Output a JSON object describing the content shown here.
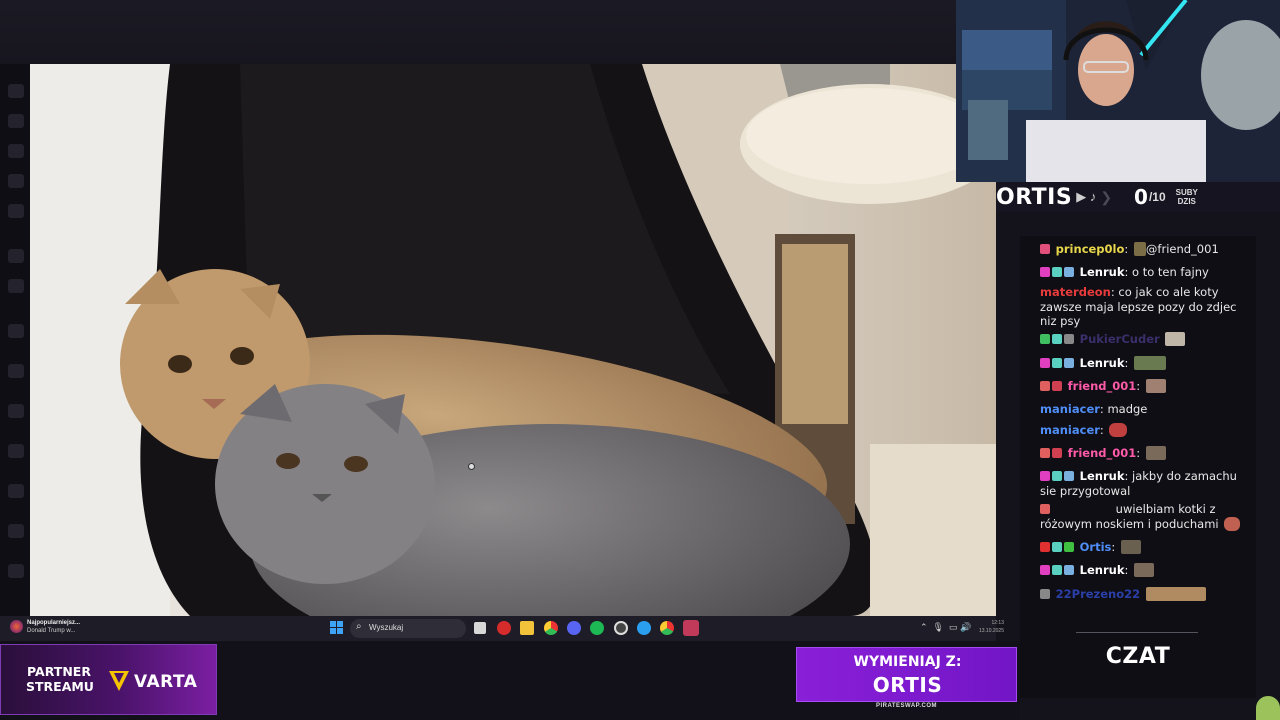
{
  "streamer": {
    "name": "ORTIS",
    "socials": "▶ ♪",
    "sub_count": "0",
    "sub_goal": "/10",
    "sub_label_1": "SUBY",
    "sub_label_2": "DZIS"
  },
  "chat": {
    "title": "CZAT",
    "messages": [
      {
        "user": "princep0lo",
        "user_color": "#e8d74a",
        "text": "@friend_001",
        "badges": [
          "#e0507a"
        ],
        "emote": true
      },
      {
        "user": "Lenruk",
        "user_color": "#ffffff",
        "text": "o to ten fajny",
        "badges": [
          "#e040c0",
          "#5ad0c0",
          "#7ab0e0"
        ],
        "emote": false
      },
      {
        "user": "materdeon",
        "user_color": "#e63b3b",
        "text": "co jak co ale koty zawsze maja lepsze pozy do zdjec niz psy",
        "badges": [],
        "emote": false
      },
      {
        "user": "PukierCuder",
        "user_color": "#3a2f6a",
        "text": "",
        "badges": [
          "#3fbf5f",
          "#5ad0c0",
          "#888888"
        ],
        "emote": true
      },
      {
        "user": "Lenruk",
        "user_color": "#ffffff",
        "text": "",
        "badges": [
          "#e040c0",
          "#5ad0c0",
          "#7ab0e0"
        ],
        "emote": true
      },
      {
        "user": "friend_001",
        "user_color": "#ff5aa8",
        "text": "",
        "badges": [
          "#e06060",
          "#d04050"
        ],
        "emote": true
      },
      {
        "user": "maniacer",
        "user_color": "#4f8ef7",
        "text": "madge",
        "badges": [],
        "emote": false
      },
      {
        "user": "maniacer",
        "user_color": "#4f8ef7",
        "text": "",
        "badges": [],
        "emote": true
      },
      {
        "user": "friend_001",
        "user_color": "#ff5aa8",
        "text": "",
        "badges": [
          "#e06060",
          "#d04050"
        ],
        "emote": true
      },
      {
        "user": "Lenruk",
        "user_color": "#ffffff",
        "text": "jakby do zamachu sie przygotowal",
        "badges": [
          "#e040c0",
          "#5ad0c0",
          "#7ab0e0"
        ],
        "emote": false
      },
      {
        "user": "",
        "user_color": "#ffffff",
        "text": "uwielbiam kotki z różowym noskiem i poduchami",
        "badges": [
          "#e06060"
        ],
        "emote": true
      },
      {
        "user": "Ortis",
        "user_color": "#4f8ef7",
        "text": "",
        "badges": [
          "#e03030",
          "#5ad0c0",
          "#40c040"
        ],
        "emote": true
      },
      {
        "user": "Lenruk",
        "user_color": "#ffffff",
        "text": "",
        "badges": [
          "#e040c0",
          "#5ad0c0",
          "#7ab0e0"
        ],
        "emote": true
      },
      {
        "user": "22Prezeno22",
        "user_color": "#2b3fa8",
        "text": "",
        "badges": [
          "#888888"
        ],
        "emote": true
      }
    ]
  },
  "taskbar": {
    "news_title": "Najpopularniejsz...",
    "news_sub": "Donald Trump w...",
    "search_placeholder": "Wyszukaj",
    "time": "12:13",
    "date": "13.10.2025"
  },
  "banners": {
    "partner_line1": "PARTNER",
    "partner_line2": "STREAMU",
    "partner_brand": "VARTA",
    "swap_line1": "WYMIENIAJ Z:",
    "swap_line2": "ORTIS",
    "swap_url": "PIRATESWAP.COM"
  },
  "colors": {
    "accent_purple": "#8a1fd8",
    "varta_yellow": "#f5c400"
  }
}
